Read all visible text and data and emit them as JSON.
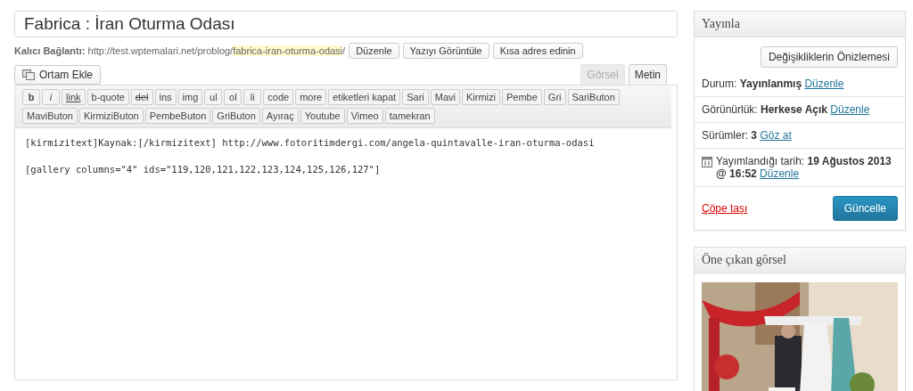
{
  "title_field": {
    "value": "Fabrica : İran Oturma Odası"
  },
  "permalink": {
    "label": "Kalıcı Bağlantı:",
    "base": "http://test.wptemalari.net/problog/",
    "slug": "fabrica-iran-oturma-odasi",
    "trail": "/"
  },
  "permalink_buttons": [
    "Düzenle",
    "Yazıyı Görüntüle",
    "Kısa adres edinin"
  ],
  "media_button": {
    "label": "Ortam Ekle"
  },
  "tabs": [
    {
      "label": "Görsel",
      "selected": false
    },
    {
      "label": "Metin",
      "selected": true
    }
  ],
  "quicktags": [
    {
      "label": "b",
      "kind": "bold"
    },
    {
      "label": "i",
      "kind": "italic"
    },
    {
      "label": "link",
      "kind": "underline"
    },
    {
      "label": "b-quote",
      "kind": "plain"
    },
    {
      "label": "del",
      "kind": "strike"
    },
    {
      "label": "ins",
      "kind": "plain"
    },
    {
      "label": "img",
      "kind": "plain"
    },
    {
      "label": "ul",
      "kind": "plain"
    },
    {
      "label": "ol",
      "kind": "plain"
    },
    {
      "label": "li",
      "kind": "plain"
    },
    {
      "label": "code",
      "kind": "plain"
    },
    {
      "label": "more",
      "kind": "plain"
    },
    {
      "label": "etiketleri kapat",
      "kind": "plain"
    },
    {
      "label": "Sari",
      "kind": "plain"
    },
    {
      "label": "Mavi",
      "kind": "plain"
    },
    {
      "label": "Kirmizi",
      "kind": "plain"
    },
    {
      "label": "Pembe",
      "kind": "plain"
    },
    {
      "label": "Gri",
      "kind": "plain"
    },
    {
      "label": "SariButon",
      "kind": "plain"
    },
    {
      "label": "MaviButon",
      "kind": "plain"
    },
    {
      "label": "KirmiziButon",
      "kind": "plain"
    },
    {
      "label": "PembeButon",
      "kind": "plain"
    },
    {
      "label": "GriButon",
      "kind": "plain"
    },
    {
      "label": "Ayıraç",
      "kind": "plain"
    },
    {
      "label": "Youtube",
      "kind": "plain"
    },
    {
      "label": "Vimeo",
      "kind": "plain"
    },
    {
      "label": "tamekran",
      "kind": "plain"
    }
  ],
  "content_lines": [
    "[kirmizitext]Kaynak:[/kirmizitext] http://www.fotoritimdergi.com/angela-quintavalle-iran-oturma-odasi",
    "[gallery columns=\"4\" ids=\"119,120,121,122,123,124,125,126,127\"]"
  ],
  "publish_box": {
    "title": "Yayınla",
    "preview_button": "Değişikliklerin Önizlemesi",
    "rows": [
      {
        "text": "Durum: **Yayınlanmış**",
        "link": "Düzenle",
        "kind": "plain"
      },
      {
        "text": "Görünürlük: **Herkese Açık**",
        "link": "Düzenle",
        "kind": "plain"
      },
      {
        "text": "Sürümler: **3**",
        "link": "Göz at",
        "kind": "plain"
      },
      {
        "text": "Yayımlandığı tarih: **19 Ağustos 2013 @ 16:52**",
        "link": "Düzenle",
        "kind": "calendar"
      }
    ],
    "trash_link": "Çöpe taşı",
    "update_button": "Güncelle"
  },
  "featured_box": {
    "title": "Öne çıkan görsel"
  }
}
